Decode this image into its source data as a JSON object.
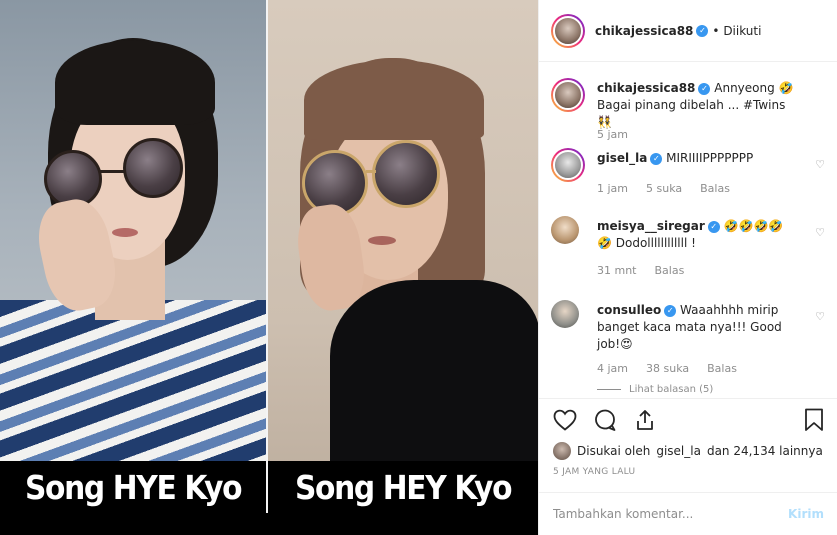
{
  "post": {
    "captions": [
      "Song HYE Kyo",
      "Song HEY Kyo"
    ]
  },
  "header": {
    "username": "chikajessica88",
    "follow_status": "• Diikuti"
  },
  "comments": [
    {
      "username": "chikajessica88",
      "text": "Annyeong 🤣 Bagai pinang dibelah ... #Twins 👯",
      "time": "5 jam",
      "likes": "",
      "reply": ""
    },
    {
      "username": "gisel_la",
      "text": "MIRIIIIPPPPPPP",
      "time": "1 jam",
      "likes": "5 suka",
      "reply": "Balas"
    },
    {
      "username": "meisya__siregar",
      "text": "🤣🤣🤣🤣 🤣 Dodollllllllllll !",
      "time": "31 mnt",
      "likes": "",
      "reply": "Balas"
    },
    {
      "username": "consulleo",
      "text": "Waaahhhh mirip banget kaca mata nya!!! Good job!😍",
      "time": "4 jam",
      "likes": "38 suka",
      "reply": "Balas"
    }
  ],
  "view_replies": "Lihat balasan (5)",
  "likes_line": {
    "prefix": "Disukai oleh",
    "user": "gisel_la",
    "suffix": "dan 24,134 lainnya"
  },
  "time_ago": "5 JAM YANG LALU",
  "add_comment": {
    "placeholder": "Tambahkan komentar...",
    "post_label": "Kirim"
  },
  "icons": [
    "heart-icon",
    "comment-icon",
    "share-icon",
    "bookmark-icon",
    "verified-icon"
  ],
  "colors": {
    "verified": "#3897f0",
    "muted": "#8e8e8e",
    "post_disabled": "#b2dffc"
  }
}
